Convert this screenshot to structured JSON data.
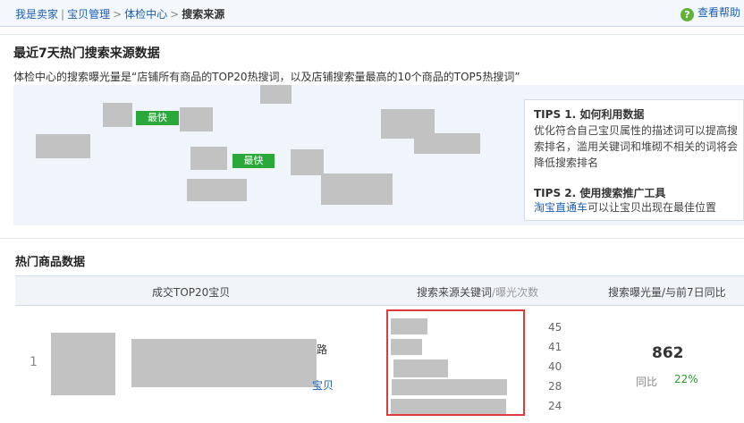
{
  "breadcrumb": [
    "我是卖家",
    "宝贝管理",
    "体检中心",
    "搜索来源"
  ],
  "help_label": "查看帮助",
  "section1": {
    "title": "最近7天热门搜索来源数据",
    "description": "体检中心的搜索曝光量是“店铺所有商品的TOP20热搜词，以及店铺搜索量最高的10个商品的TOP5热搜词”",
    "fast_badge": "最快"
  },
  "tips": {
    "tip1_title": "TIPS 1. 如何利用数据",
    "tip1_text": "优化符合自己宝贝属性的描述词可以提高搜索排名，滥用关键词和堆砌不相关的词将会降低搜索排名",
    "tip2_title": "TIPS 2. 使用搜索推广工具",
    "tip2_link": "淘宝直通车",
    "tip2_text": "可以让宝贝出现在最佳位置"
  },
  "section2": {
    "title": "热门商品数据",
    "columns": {
      "item": "成交TOP20宝贝",
      "keyword": "搜索来源关键词",
      "keyword_sep": "/",
      "exposure_count": "曝光次数",
      "exposure": "搜索曝光量/与前7日同比"
    },
    "row": {
      "rank": "1",
      "title_fragment": "路",
      "link_fragment": "宝贝",
      "counts": [
        "45",
        "41",
        "40",
        "28",
        "24"
      ],
      "exposure": "862",
      "compare_label": "同比",
      "compare_value": "22%"
    }
  }
}
